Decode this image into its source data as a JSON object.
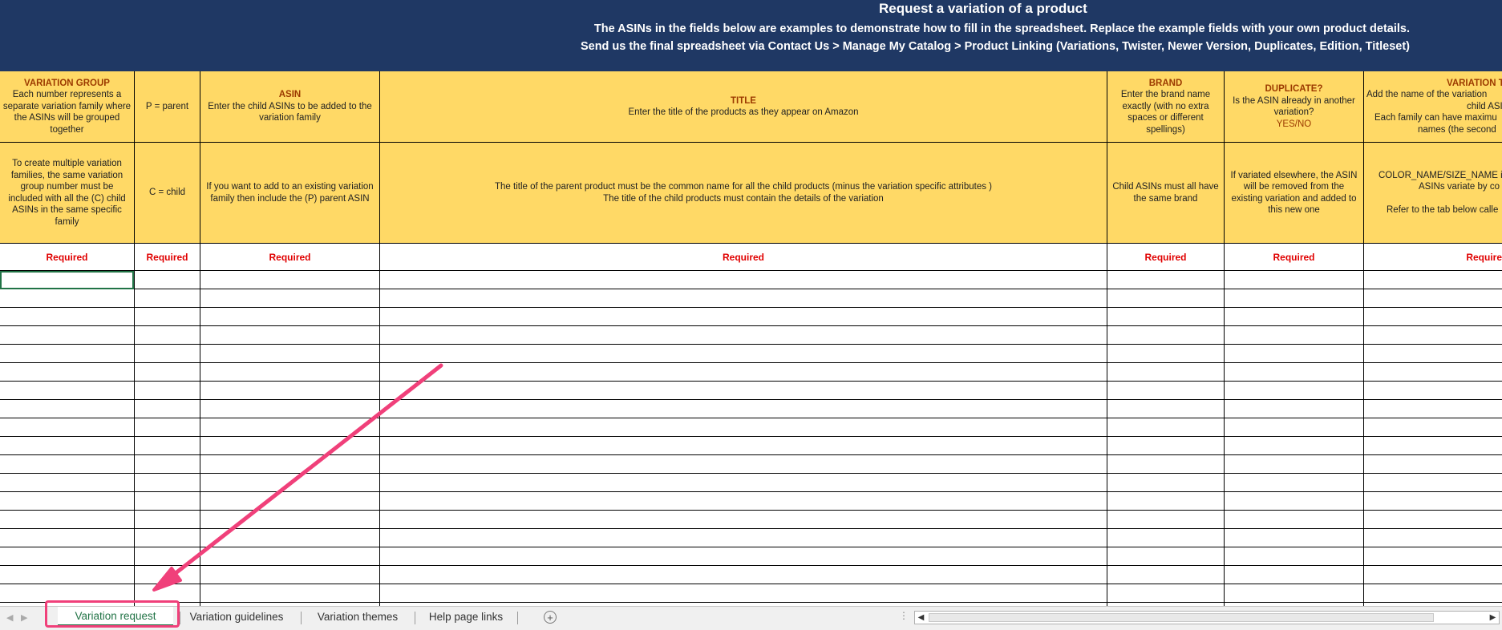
{
  "banner": {
    "title": "Request a variation of a product",
    "line1": "The ASINs in the fields below are examples to demonstrate how to fill in the spreadsheet. Replace the example fields with your own product details.",
    "line2": "Send us the final spreadsheet via Contact Us > Manage My Catalog > Product Linking (Variations, Twister, Newer Version, Duplicates, Edition, Titleset)"
  },
  "columns": {
    "variation_group": {
      "title": "VARIATION GROUP",
      "desc": "Each number represents a separate variation family where the ASINs will be grouped together",
      "note": "To create multiple variation families, the same variation group number must be included with all the (C) child ASINs in the same specific family",
      "required": "Required"
    },
    "parent_child": {
      "desc": "P = parent",
      "note": "C = child",
      "required": "Required"
    },
    "asin": {
      "title": "ASIN",
      "desc": "Enter the child ASINs to be added to the variation family",
      "note": "If you want to add to an existing variation family then include the (P) parent ASIN",
      "required": "Required"
    },
    "title": {
      "title": "TITLE",
      "desc": "Enter the title of the products as they appear on Amazon",
      "note1": "The title of the parent product must be the common name for all the child products (minus the variation specific attributes )",
      "note2": "The title of the child products must contain the details of the variation",
      "required": "Required"
    },
    "brand": {
      "title": "BRAND",
      "desc": "Enter the brand name exactly (with no extra spaces or different spellings)",
      "note": "Child ASINs must all have the same brand",
      "required": "Required"
    },
    "duplicate": {
      "title": "DUPLICATE?",
      "desc": "Is the ASIN already in another variation?",
      "yesno": "YES/NO",
      "note": "If variated elsewhere, the ASIN will be removed from the existing variation and added to this new one",
      "required": "Required"
    },
    "variation_theme": {
      "title": "VARIATION T",
      "desc1": "Add the name of the variation",
      "desc2": "child ASI",
      "desc3": "Each family can have maximu",
      "desc4": "names (the second",
      "note1": "COLOR_NAME/SIZE_NAME i",
      "note2": "ASINs variate by co",
      "note3": "Refer to the tab below calle",
      "required": "Require"
    }
  },
  "sheet_tabs": [
    {
      "label": "Variation request",
      "active": true
    },
    {
      "label": "Variation guidelines",
      "active": false
    },
    {
      "label": "Variation themes",
      "active": false
    },
    {
      "label": "Help page links",
      "active": false
    }
  ],
  "colors": {
    "banner_bg": "#1f3864",
    "header_bg": "#ffd966",
    "title_text": "#9c3a00",
    "required_text": "#e00000",
    "annotation": "#f0407a",
    "active_tab": "#217346"
  }
}
